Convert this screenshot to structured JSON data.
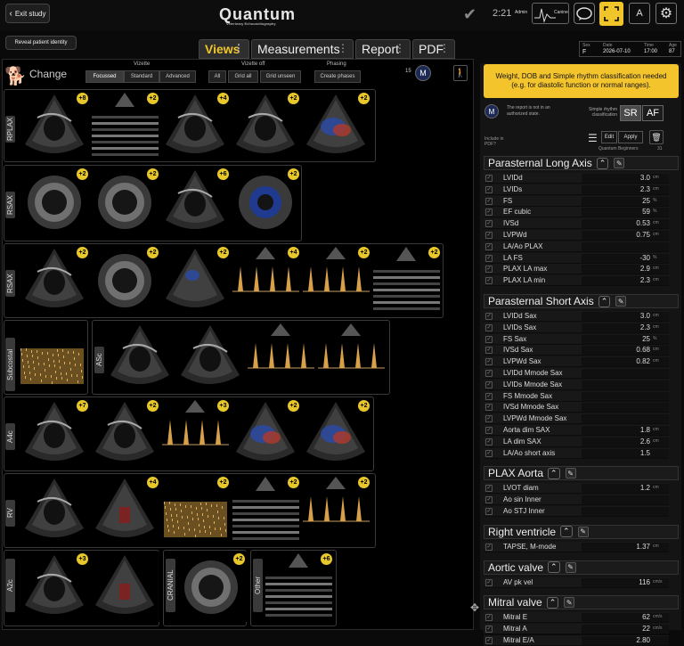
{
  "topbar": {
    "exit_label": "Exit study",
    "logo": "Quantum",
    "logo_sub": "Veterinary Echocardiography",
    "time": "2:21",
    "admin": "Admin",
    "canine": "Canine",
    "reveal_label": "Reveal patient identity"
  },
  "tabs": [
    {
      "label": "Views"
    },
    {
      "label": "Measurements"
    },
    {
      "label": "Report"
    },
    {
      "label": "PDF"
    }
  ],
  "patient": {
    "sex_label": "Sex",
    "sex": "F",
    "date_label": "Date",
    "date": "2026-07-10",
    "time_label": "Time",
    "time": "17:00",
    "age_label": "Age",
    "age": "87"
  },
  "views": {
    "change_label": "Change",
    "vizette_label": "Vizette",
    "vizette_opts": [
      "Focussed",
      "Standard",
      "Advanced"
    ],
    "vizette_off_label": "Vizette off",
    "vizette_off_opts": [
      "All",
      "Grid all",
      "Grid unseen"
    ],
    "phasing_label": "Phasing",
    "phasing_btn": "Create phases",
    "count": "15",
    "groups": [
      {
        "label": "RPLAX",
        "badges": [
          "8",
          "2",
          "4",
          "2",
          "2"
        ]
      },
      {
        "label": "RSAX",
        "badges": [
          "2",
          "2",
          "6",
          "2"
        ]
      },
      {
        "label": "RSAX",
        "badges": [
          "2",
          "2",
          "2",
          "4",
          "2",
          "2"
        ]
      },
      {
        "label": "Subcostal",
        "badges": []
      },
      {
        "label": "ASc",
        "badges": [
          "",
          "",
          "",
          ""
        ]
      },
      {
        "label": "A4c",
        "badges": [
          "7",
          "2",
          "3",
          "2",
          "2"
        ]
      },
      {
        "label": "RV",
        "badges": [
          "",
          "4",
          "2",
          "2",
          "2"
        ]
      },
      {
        "label": "A2c",
        "badges": [
          "3",
          ""
        ]
      },
      {
        "label": "CRANIAL",
        "badges": [
          "2"
        ]
      },
      {
        "label": "Other",
        "badges": [
          "6"
        ]
      }
    ]
  },
  "measurements": {
    "warning": "Weight, DOB and Simple rhythm classification needed (e.g. for diastolic function or normal ranges).",
    "report_note": "The report is not in an authorized state.",
    "rhythm_label": "Simple rhythm classification",
    "sr": "SR",
    "af": "AF",
    "include_pdf": "Include in PDF?",
    "edit": "Edit",
    "apply": "Apply",
    "preset": "Quantum Beginners",
    "preset_n": "31",
    "sections": [
      {
        "title": "Parasternal Long Axis",
        "rows": [
          {
            "name": "LVIDd",
            "value": "3.0",
            "unit": "cm"
          },
          {
            "name": "LVIDs",
            "value": "2.3",
            "unit": "cm"
          },
          {
            "name": "FS",
            "value": "25",
            "unit": "%"
          },
          {
            "name": "EF cubic",
            "value": "59",
            "unit": "%"
          },
          {
            "name": "IVSd",
            "value": "0.53",
            "unit": "cm"
          },
          {
            "name": "LVPWd",
            "value": "0.75",
            "unit": "cm"
          },
          {
            "name": "LA/Ao PLAX",
            "value": "",
            "unit": ""
          },
          {
            "name": "LA FS",
            "value": "-30",
            "unit": "%"
          },
          {
            "name": "PLAX LA max",
            "value": "2.9",
            "unit": "cm"
          },
          {
            "name": "PLAX LA min",
            "value": "2.3",
            "unit": "cm"
          }
        ]
      },
      {
        "title": "Parasternal Short Axis",
        "rows": [
          {
            "name": "LVIDd Sax",
            "value": "3.0",
            "unit": "cm"
          },
          {
            "name": "LVIDs Sax",
            "value": "2.3",
            "unit": "cm"
          },
          {
            "name": "FS Sax",
            "value": "25",
            "unit": "%"
          },
          {
            "name": "IVSd Sax",
            "value": "0.68",
            "unit": "cm"
          },
          {
            "name": "LVPWd Sax",
            "value": "0.82",
            "unit": "cm"
          },
          {
            "name": "LVIDd Mmode Sax",
            "value": "",
            "unit": ""
          },
          {
            "name": "LVIDs Mmode Sax",
            "value": "",
            "unit": ""
          },
          {
            "name": "FS Mmode Sax",
            "value": "",
            "unit": ""
          },
          {
            "name": "IVSd Mmode Sax",
            "value": "",
            "unit": ""
          },
          {
            "name": "LVPWd Mmode Sax",
            "value": "",
            "unit": ""
          },
          {
            "name": "Aorta dim SAX",
            "value": "1.8",
            "unit": "cm"
          },
          {
            "name": "LA dim SAX",
            "value": "2.6",
            "unit": "cm"
          },
          {
            "name": "LA/Ao short axis",
            "value": "1.5",
            "unit": ""
          }
        ]
      },
      {
        "title": "PLAX Aorta",
        "rows": [
          {
            "name": "LVOT diam",
            "value": "1.2",
            "unit": "cm"
          },
          {
            "name": "Ao sin Inner",
            "value": "",
            "unit": ""
          },
          {
            "name": "Ao STJ Inner",
            "value": "",
            "unit": ""
          }
        ]
      },
      {
        "title": "Right ventricle",
        "rows": [
          {
            "name": "TAPSE, M-mode",
            "value": "1.37",
            "unit": "cm"
          }
        ]
      },
      {
        "title": "Aortic valve",
        "rows": [
          {
            "name": "AV pk vel",
            "value": "116",
            "unit": "cm/s"
          }
        ]
      },
      {
        "title": "Mitral valve",
        "rows": [
          {
            "name": "Mitral E",
            "value": "62",
            "unit": "cm/s"
          },
          {
            "name": "Mitral A",
            "value": "22",
            "unit": "cm/s"
          },
          {
            "name": "Mitral E/A",
            "value": "2.80",
            "unit": ""
          }
        ]
      }
    ]
  }
}
